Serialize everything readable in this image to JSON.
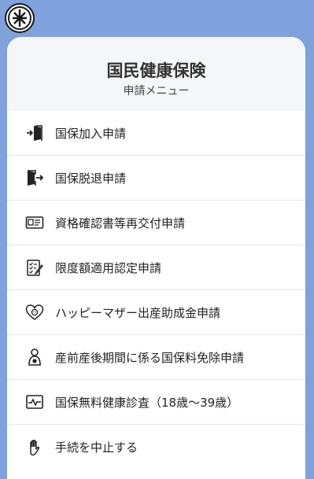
{
  "header": {
    "title": "国民健康保険",
    "subtitle": "申請メニュー"
  },
  "menu": {
    "items": [
      {
        "label": "国保加入申請",
        "icon": "door-enter-icon"
      },
      {
        "label": "国保脱退申請",
        "icon": "door-exit-icon"
      },
      {
        "label": "資格確認書等再交付申請",
        "icon": "id-card-icon"
      },
      {
        "label": "限度額適用認定申請",
        "icon": "checklist-icon"
      },
      {
        "label": "ハッピーマザー出産助成金申請",
        "icon": "baby-heart-icon"
      },
      {
        "label": "産前産後期間に係る国保料免除申請",
        "icon": "mother-icon"
      },
      {
        "label": "国保無料健康診査（18歳～39歳）",
        "icon": "health-monitor-icon"
      },
      {
        "label": "手続を中止する",
        "icon": "hand-stop-icon"
      }
    ]
  },
  "colors": {
    "background": "#7fa2dc",
    "header_background": "#f5f6f8"
  }
}
